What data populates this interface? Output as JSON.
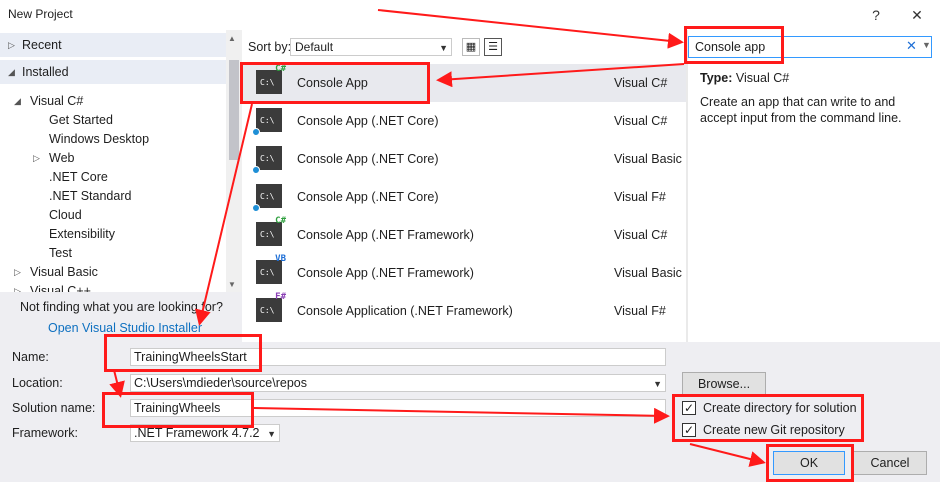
{
  "window": {
    "title": "New Project",
    "help": "?",
    "close": "✕"
  },
  "tree": {
    "recent": "Recent",
    "installed": "Installed",
    "items": [
      {
        "label": "Visual C#",
        "expanded": true
      },
      {
        "label": "Get Started"
      },
      {
        "label": "Windows Desktop"
      },
      {
        "label": "Web",
        "collapsed": true
      },
      {
        "label": ".NET Core"
      },
      {
        "label": ".NET Standard"
      },
      {
        "label": "Cloud"
      },
      {
        "label": "Extensibility"
      },
      {
        "label": "Test"
      },
      {
        "label": "Visual Basic",
        "collapsed": true
      },
      {
        "label": "Visual C++",
        "collapsed": true
      }
    ],
    "not_finding": "Not finding what you are looking for?",
    "installer_link": "Open Visual Studio Installer"
  },
  "sort": {
    "label": "Sort by:",
    "value": "Default"
  },
  "templates": [
    {
      "name": "Console App",
      "lang": "Visual C#",
      "badge": "C#",
      "selected": true
    },
    {
      "name": "Console App (.NET Core)",
      "lang": "Visual C#"
    },
    {
      "name": "Console App (.NET Core)",
      "lang": "Visual Basic"
    },
    {
      "name": "Console App (.NET Core)",
      "lang": "Visual F#"
    },
    {
      "name": "Console App (.NET Framework)",
      "lang": "Visual C#",
      "badge": "C#"
    },
    {
      "name": "Console App (.NET Framework)",
      "lang": "Visual Basic",
      "badge": "VB"
    },
    {
      "name": "Console Application (.NET Framework)",
      "lang": "Visual F#",
      "badge": "F#"
    }
  ],
  "search": {
    "value": "Console app"
  },
  "details": {
    "type_label": "Type:",
    "type_value": "Visual C#",
    "description": "Create an app that can write to and accept input from the command line."
  },
  "form": {
    "name_label": "Name:",
    "name_value": "TrainingWheelsStart",
    "location_label": "Location:",
    "location_value": "C:\\Users\\mdieder\\source\\repos",
    "solution_label": "Solution name:",
    "solution_value": "TrainingWheels",
    "framework_label": "Framework:",
    "framework_value": ".NET Framework 4.7.2",
    "browse": "Browse...",
    "create_dir": "Create directory for solution",
    "create_git": "Create new Git repository",
    "ok": "OK",
    "cancel": "Cancel"
  },
  "colors": {
    "annotation": "#ff1a1a",
    "link": "#0e70c0",
    "selection": "#e8e9ee"
  }
}
